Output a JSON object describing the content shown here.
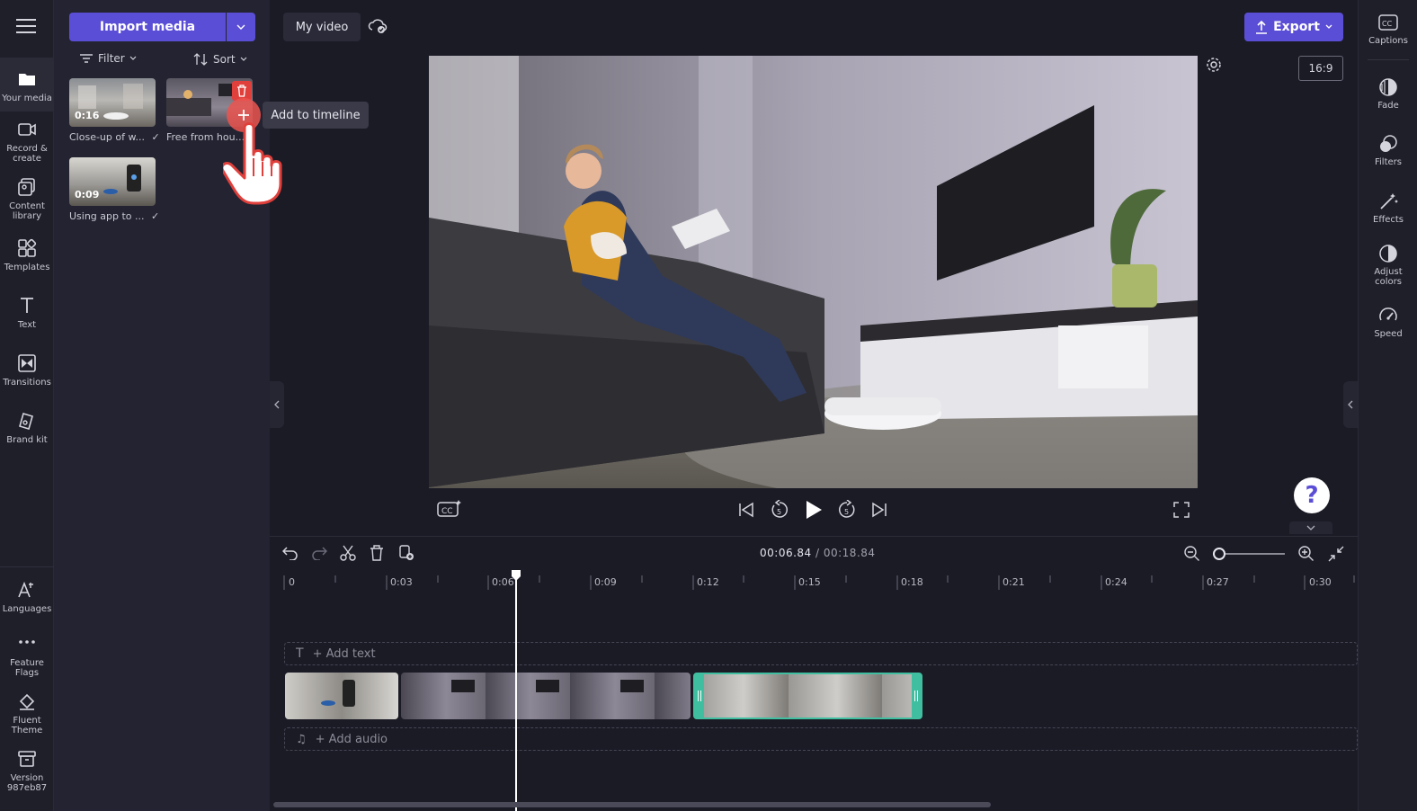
{
  "left_nav": {
    "items": [
      {
        "label": "Your media",
        "icon": "folder-icon"
      },
      {
        "label": "Record & create",
        "icon": "camera-icon"
      },
      {
        "label": "Content library",
        "icon": "library-icon"
      },
      {
        "label": "Templates",
        "icon": "templates-icon"
      },
      {
        "label": "Text",
        "icon": "text-icon"
      },
      {
        "label": "Transitions",
        "icon": "transitions-icon"
      },
      {
        "label": "Brand kit",
        "icon": "brand-kit-icon"
      }
    ],
    "bottom_items": [
      {
        "label": "Languages",
        "icon": "languages-icon"
      },
      {
        "label": "Feature Flags",
        "icon": "more-icon"
      },
      {
        "label": "Fluent Theme",
        "icon": "paint-bucket-icon"
      },
      {
        "label": "Version 987eb87",
        "icon": "archive-icon"
      }
    ]
  },
  "media_panel": {
    "import_label": "Import media",
    "filter_label": "Filter",
    "sort_label": "Sort",
    "items": [
      {
        "duration": "0:16",
        "label": "Close-up of w..."
      },
      {
        "duration": "",
        "label": "Free from hou..."
      },
      {
        "duration": "0:09",
        "label": "Using app to ..."
      }
    ],
    "tooltip": "Add to timeline"
  },
  "topbar": {
    "title": "My video",
    "export_label": "Export",
    "aspect_ratio": "16:9"
  },
  "right_panel": {
    "items": [
      {
        "label": "Captions",
        "icon": "captions-icon"
      },
      {
        "label": "Fade",
        "icon": "fade-icon"
      },
      {
        "label": "Filters",
        "icon": "filters-icon"
      },
      {
        "label": "Effects",
        "icon": "effects-icon"
      },
      {
        "label": "Adjust colors",
        "icon": "adjust-colors-icon"
      },
      {
        "label": "Speed",
        "icon": "speed-icon"
      }
    ]
  },
  "playback": {
    "current": "00:06.84",
    "total": "/ 00:18.84",
    "help": "?"
  },
  "timeline": {
    "ticks": [
      "0",
      "0:03",
      "0:06",
      "0:09",
      "0:12",
      "0:15",
      "0:18",
      "0:21",
      "0:24",
      "0:27",
      "0:30"
    ],
    "add_text": "+ Add text",
    "add_audio": "+ Add audio"
  },
  "colors": {
    "accent": "#5b4ed6",
    "selected_clip": "#3fbf9f",
    "background": "#1b1b26"
  }
}
